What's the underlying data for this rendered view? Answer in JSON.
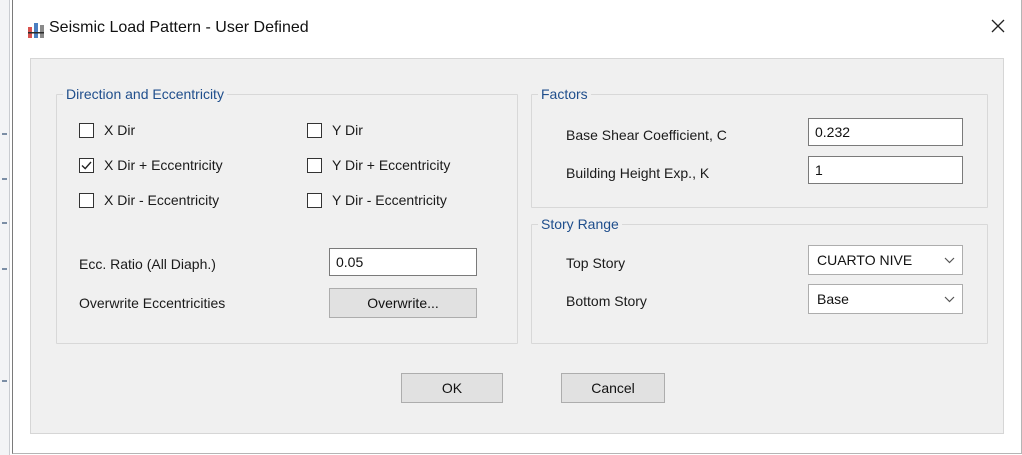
{
  "window": {
    "title": "Seismic Load Pattern - User Defined"
  },
  "direction": {
    "title": "Direction and Eccentricity",
    "checkboxes": [
      {
        "label": "X Dir",
        "checked": false
      },
      {
        "label": "X Dir + Eccentricity",
        "checked": true
      },
      {
        "label": "X Dir - Eccentricity",
        "checked": false
      },
      {
        "label": "Y Dir",
        "checked": false
      },
      {
        "label": "Y Dir + Eccentricity",
        "checked": false
      },
      {
        "label": "Y Dir - Eccentricity",
        "checked": false
      }
    ],
    "ecc_ratio_label": "Ecc. Ratio (All Diaph.)",
    "ecc_ratio_value": "0.05",
    "overwrite_label": "Overwrite Eccentricities",
    "overwrite_button": "Overwrite..."
  },
  "factors": {
    "title": "Factors",
    "base_shear_label": "Base Shear Coefficient, C",
    "base_shear_value": "0.232",
    "height_exp_label": "Building Height Exp., K",
    "height_exp_value": "1"
  },
  "story_range": {
    "title": "Story Range",
    "top_label": "Top Story",
    "top_value": "CUARTO NIVE",
    "bottom_label": "Bottom Story",
    "bottom_value": "Base"
  },
  "buttons": {
    "ok": "OK",
    "cancel": "Cancel"
  },
  "icons": {
    "app": "etabs-app-icon",
    "close": "close-icon",
    "check": "checkmark-icon",
    "dropdown": "chevron-down-icon"
  },
  "colors": {
    "group_title": "#1f4e8c",
    "dialog_bg": "#f0f0f0",
    "button_bg": "#e1e1e1"
  }
}
